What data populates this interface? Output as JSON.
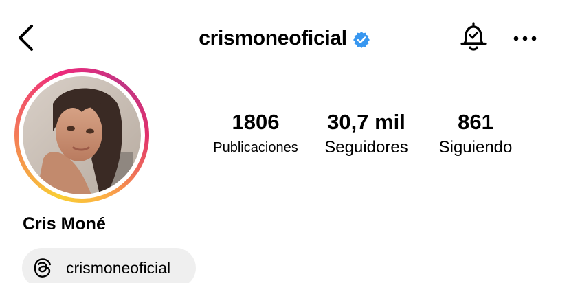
{
  "header": {
    "back_icon": "chevron-left-icon",
    "username": "crismoneoficial",
    "verified_icon": "verified-badge-icon",
    "verified_color": "#3897f0",
    "notification_icon": "bell-check-icon",
    "more_icon": "more-horizontal-icon"
  },
  "profile": {
    "avatar_icon": "profile-photo",
    "story_ring_colors": [
      "#f9ce34",
      "#ee2a7b",
      "#c13584"
    ],
    "full_name": "Cris Moné"
  },
  "stats": {
    "posts": {
      "value": "1806",
      "label": "Publicaciones"
    },
    "followers": {
      "value": "30,7 mil",
      "label": "Seguidores"
    },
    "following": {
      "value": "861",
      "label": "Siguiendo"
    }
  },
  "threads_link": {
    "icon": "threads-icon",
    "label": "crismoneoficial",
    "background": "#efefef"
  }
}
